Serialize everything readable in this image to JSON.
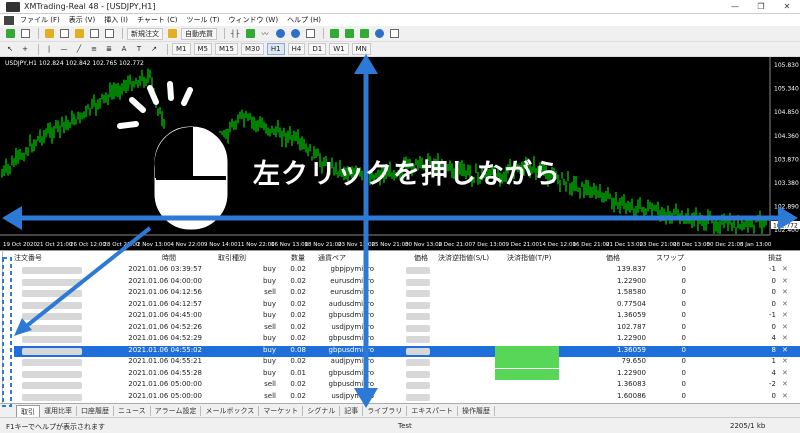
{
  "window": {
    "title": "XMTrading-Real 48 - [USDJPY,H1]",
    "controls": [
      "—",
      "❐",
      "✕"
    ]
  },
  "menu": {
    "items": [
      "ファイル (F)",
      "表示 (V)",
      "挿入 (I)",
      "チャート (C)",
      "ツール (T)",
      "ウィンドウ (W)",
      "ヘルプ (H)"
    ],
    "mdi_controls": [
      "_",
      "❐",
      "✕"
    ]
  },
  "toolbar": {
    "new_order_label": "新規注文",
    "auto_trade_label": "自動売買",
    "timeframes": [
      "M1",
      "M5",
      "M15",
      "M30",
      "H1",
      "H4",
      "D1",
      "W1",
      "MN"
    ],
    "active_timeframe": "H1"
  },
  "chart": {
    "symbol_info": "USDJPY,H1  102.824 102.842 102.765 102.772",
    "price_ticks": [
      "105.830",
      "105.340",
      "104.850",
      "104.360",
      "103.870",
      "103.380",
      "102.890",
      "102.400"
    ],
    "current_price": "102.772",
    "time_ticks": [
      "19 Oct 2020",
      "21 Oct 21:00",
      "26 Oct 12:00",
      "28 Oct 21:00",
      "2 Nov 13:00",
      "4 Nov 22:00",
      "9 Nov 14:00",
      "11 Nov 22:00",
      "16 Nov 13:00",
      "18 Nov 21:00",
      "23 Nov 13:00",
      "25 Nov 21:00",
      "30 Nov 13:00",
      "2 Dec 21:00",
      "7 Dec 13:00",
      "9 Dec 21:00",
      "14 Dec 12:00",
      "16 Dec 21:00",
      "21 Dec 13:00",
      "23 Dec 21:00",
      "28 Dec 13:00",
      "30 Dec 21:00",
      "5 Jan 13:00"
    ],
    "overlay_caption": "左クリックを押しながら",
    "colors": {
      "background": "#000000",
      "candles": "#00ff00",
      "arrow": "#2d7ad6"
    }
  },
  "terminal": {
    "columns": [
      "注文番号",
      "時間",
      "取引種別",
      "数量",
      "通貨ペア",
      "価格",
      "決済逆指値(S/L)",
      "決済指値(T/P)",
      "価格",
      "スワップ",
      "損益"
    ],
    "rows": [
      {
        "time": "2021.01.06 03:39:57",
        "type": "buy",
        "lots": "0.02",
        "symbol": "gbpjpymicro",
        "price_now": "139.837",
        "swap": "0",
        "profit": "-1"
      },
      {
        "time": "2021.01.06 04:00:00",
        "type": "buy",
        "lots": "0.02",
        "symbol": "eurusdmicro",
        "price_now": "1.22900",
        "swap": "0",
        "profit": "0"
      },
      {
        "time": "2021.01.06 04:12:56",
        "type": "sell",
        "lots": "0.02",
        "symbol": "eurusdmicro",
        "price_now": "1.58580",
        "swap": "0",
        "profit": "0"
      },
      {
        "time": "2021.01.06 04:12:57",
        "type": "buy",
        "lots": "0.02",
        "symbol": "audusdmicro",
        "price_now": "0.77504",
        "swap": "0",
        "profit": "0"
      },
      {
        "time": "2021.01.06 04:45:00",
        "type": "buy",
        "lots": "0.02",
        "symbol": "gbpusdmicro",
        "price_now": "1.36059",
        "swap": "0",
        "profit": "-1"
      },
      {
        "time": "2021.01.06 04:52:26",
        "type": "sell",
        "lots": "0.02",
        "symbol": "usdjpymicro",
        "price_now": "102.787",
        "swap": "0",
        "profit": "0"
      },
      {
        "time": "2021.01.06 04:52:29",
        "type": "buy",
        "lots": "0.02",
        "symbol": "gbpusdmicro",
        "price_now": "1.22900",
        "swap": "0",
        "profit": "4"
      },
      {
        "time": "2021.01.06 04:55:02",
        "type": "buy",
        "lots": "0.08",
        "symbol": "gbpusdmicro",
        "price_now": "1.36059",
        "swap": "0",
        "profit": "8",
        "selected": true
      },
      {
        "time": "2021.01.06 04:55:21",
        "type": "buy",
        "lots": "0.02",
        "symbol": "audjpymicro",
        "price_now": "79.650",
        "swap": "0",
        "profit": "1"
      },
      {
        "time": "2021.01.06 04:55:28",
        "type": "buy",
        "lots": "0.01",
        "symbol": "gbpusdmicro",
        "price_now": "1.22900",
        "swap": "0",
        "profit": "4"
      },
      {
        "time": "2021.01.06 05:00:00",
        "type": "sell",
        "lots": "0.02",
        "symbol": "gbpusdmicro",
        "price_now": "1.36083",
        "swap": "0",
        "profit": "-2"
      },
      {
        "time": "2021.01.06 05:00:00",
        "type": "sell",
        "lots": "0.02",
        "symbol": "usdjpymicro",
        "price_now": "1.60086",
        "swap": "0",
        "profit": "0"
      }
    ]
  },
  "tabs": {
    "items": [
      "取引",
      "運用比率",
      "口座履歴",
      "ニュース",
      "アラーム設定",
      "メールボックス",
      "マーケット",
      "シグナル",
      "記事",
      "ライブラリ",
      "エキスパート",
      "操作履歴"
    ],
    "active": "取引"
  },
  "status": {
    "help": "F1キーでヘルプが表示されます",
    "profile": "Test",
    "traffic": "2205/1 kb"
  }
}
